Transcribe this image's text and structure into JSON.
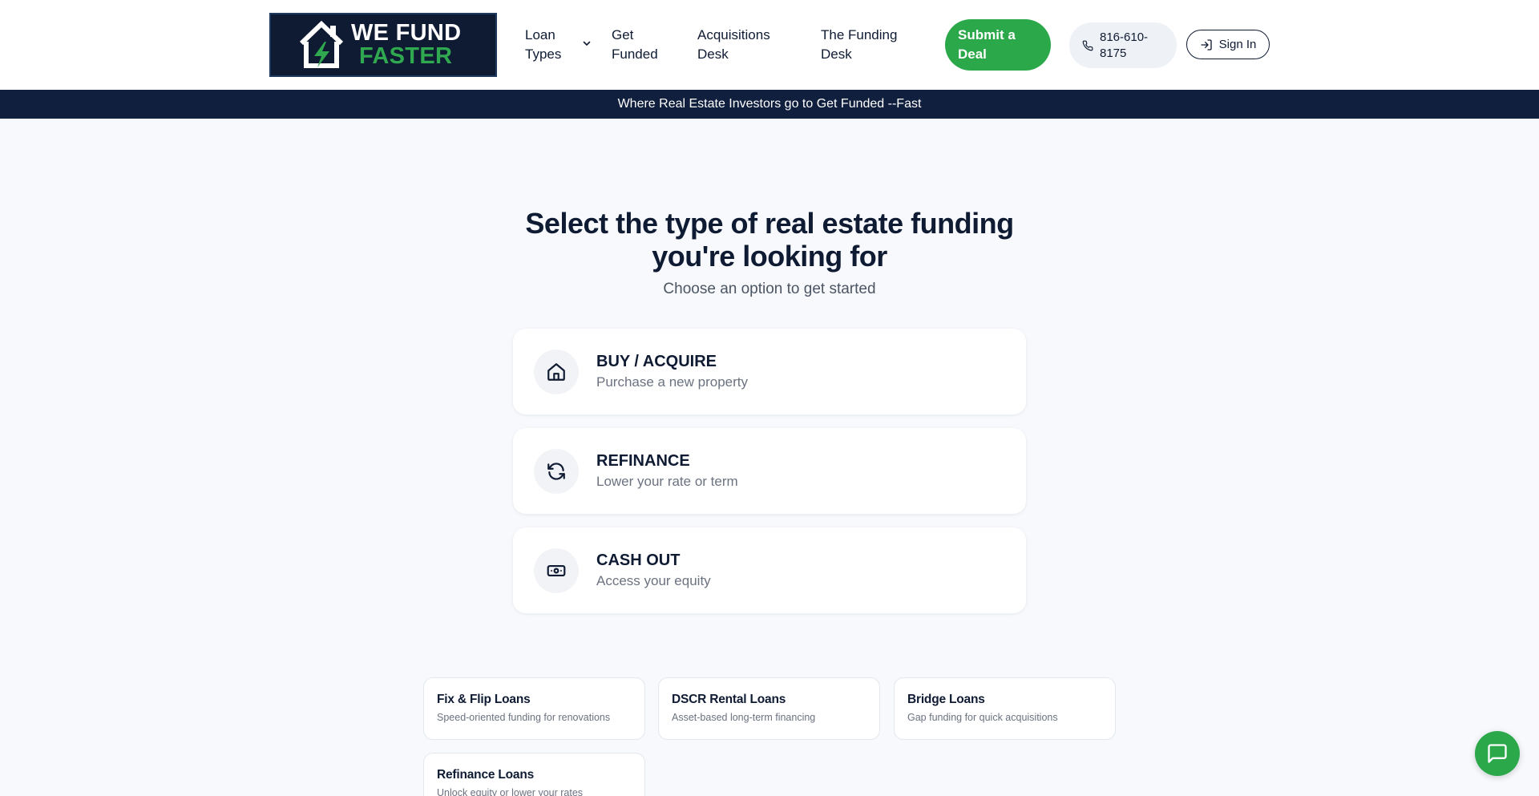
{
  "header": {
    "logo": {
      "line1": "WE FUND",
      "line2": "FASTER"
    },
    "nav": [
      {
        "label": "Loan Types"
      },
      {
        "label": "Get Funded"
      },
      {
        "label": "Acquisitions Desk"
      },
      {
        "label": "The Funding Desk"
      }
    ],
    "submit_label": "Submit a Deal",
    "phone": "816-610-8175",
    "signin_label": "Sign In"
  },
  "banner": {
    "text": "Where Real Estate Investors go to Get Funded --Fast"
  },
  "hero": {
    "title_line1": "Select the type of real estate funding",
    "title_line2": "you're looking for",
    "subtitle": "Choose an option to get started"
  },
  "options": [
    {
      "title": "BUY / ACQUIRE",
      "desc": "Purchase a new property",
      "icon": "home-icon"
    },
    {
      "title": "REFINANCE",
      "desc": "Lower your rate or term",
      "icon": "refresh-icon"
    },
    {
      "title": "CASH OUT",
      "desc": "Access your equity",
      "icon": "cash-icon"
    }
  ],
  "loans": [
    {
      "title": "Fix & Flip Loans",
      "desc": "Speed-oriented funding for renovations"
    },
    {
      "title": "DSCR Rental Loans",
      "desc": "Asset-based long-term financing"
    },
    {
      "title": "Bridge Loans",
      "desc": "Gap funding for quick acquisitions"
    },
    {
      "title": "Refinance Loans",
      "desc": "Unlock equity or lower your rates"
    }
  ],
  "colors": {
    "navy": "#0f1b33",
    "green": "#2aa84a",
    "banner": "#0f1f3d"
  }
}
